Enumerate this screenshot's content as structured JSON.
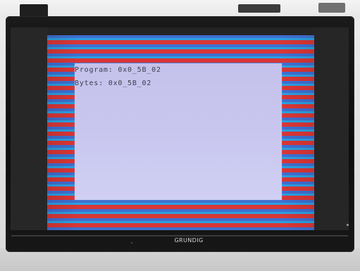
{
  "screen": {
    "lines": [
      "Program: 0x0_5B_02",
      "Bytes: 0x0_5B_02"
    ],
    "brand": "GRUNDIG"
  },
  "colors": {
    "stripe_blue": "#3f6fd0",
    "stripe_cyan": "#2c9fe0",
    "stripe_red": "#d93636",
    "overlay_lavender": "#c4c2eb",
    "bezel_black": "#111111"
  }
}
